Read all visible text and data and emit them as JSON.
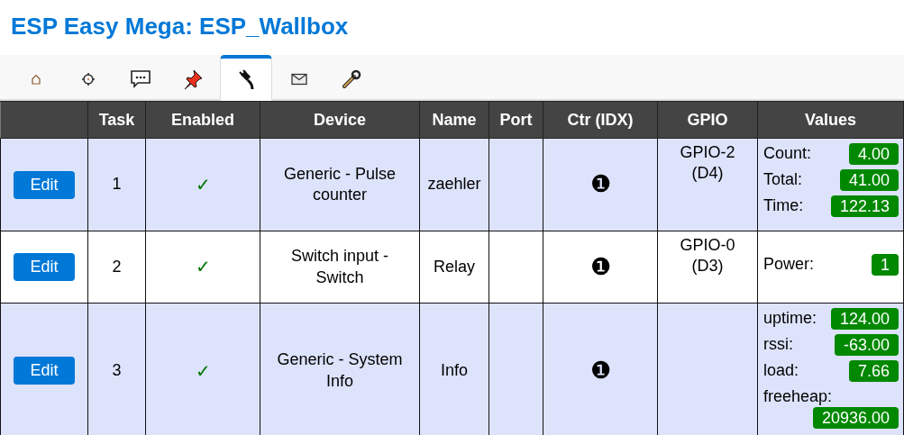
{
  "title": "ESP Easy Mega: ESP_Wallbox",
  "tabs": [
    {
      "kind": "home",
      "selected": false
    },
    {
      "kind": "config",
      "selected": false
    },
    {
      "kind": "chat",
      "selected": false
    },
    {
      "kind": "pin",
      "selected": false
    },
    {
      "kind": "plug",
      "selected": true
    },
    {
      "kind": "mail",
      "selected": false
    },
    {
      "kind": "wrench",
      "selected": false
    }
  ],
  "table": {
    "columns": [
      "",
      "Task",
      "Enabled",
      "Device",
      "Name",
      "Port",
      "Ctr (IDX)",
      "GPIO",
      "Values"
    ],
    "rows": [
      {
        "button": "Edit",
        "task": "1",
        "enabled": true,
        "enabled_mark": "✓",
        "device": "Generic - Pulse counter",
        "name": "zaehler",
        "port": "",
        "ctr": "❶",
        "gpio": "GPIO-2 (D4)",
        "values": [
          {
            "label": "Count:",
            "value": "4.00"
          },
          {
            "label": "Total:",
            "value": "41.00"
          },
          {
            "label": "Time:",
            "value": "122.13"
          }
        ]
      },
      {
        "button": "Edit",
        "task": "2",
        "enabled": true,
        "enabled_mark": "✓",
        "device": "Switch input - Switch",
        "name": "Relay",
        "port": "",
        "ctr": "❶",
        "gpio": "GPIO-0 (D3)",
        "values": [
          {
            "label": "Power:",
            "value": "1"
          }
        ]
      },
      {
        "button": "Edit",
        "task": "3",
        "enabled": true,
        "enabled_mark": "✓",
        "device": "Generic - System Info",
        "name": "Info",
        "port": "",
        "ctr": "❶",
        "gpio": "",
        "values": [
          {
            "label": "uptime:",
            "value": "124.00"
          },
          {
            "label": "rssi:",
            "value": "-63.00"
          },
          {
            "label": "load:",
            "value": "7.66"
          },
          {
            "label": "freeheap:",
            "value": "20936.00"
          }
        ]
      }
    ]
  }
}
